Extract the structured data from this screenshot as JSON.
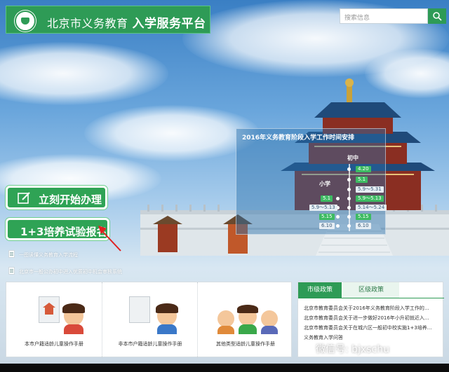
{
  "header": {
    "site_name": "北京市义务教育",
    "platform_name": "入学服务平台"
  },
  "search": {
    "placeholder": "搜索信息",
    "icon": "search-icon"
  },
  "schedule": {
    "title": "2016年义务教育阶段入学工作时间安排",
    "junior_label": "初中",
    "primary_label": "小学",
    "junior_dates": [
      "4.20",
      "5.1",
      "5.9～5.31",
      "5.9～5.13",
      "5.14～5.24",
      "5.15",
      "6.10"
    ],
    "primary_dates": [
      "5.1",
      "5.9～5.13",
      "5.15",
      "6.10"
    ]
  },
  "actions": {
    "start_label": "立刻开始办理",
    "start_icon": "pen-icon",
    "signup_label": "1+3培养试验报名"
  },
  "links": [
    {
      "label": "一图读懂义务教育入学流程"
    },
    {
      "label": "北京市一般公办初中进入优质初中机会审核系统"
    }
  ],
  "manuals": [
    {
      "label": "本市户籍适龄儿童操作手册"
    },
    {
      "label": "非本市户籍适龄儿童操作手册"
    },
    {
      "label": "其他类型适龄儿童操作手册"
    }
  ],
  "policy": {
    "tabs": [
      "市级政策",
      "区级政策"
    ],
    "items": [
      "北京市教育委员会关于2016年义务教育阶段入学工作的...",
      "北京市教育委员会关于进一步做好2016年小升初就近入...",
      "北京市教育委员会关于在城六区一般初中校实施1+3培养...",
      "义务教育入学问答"
    ]
  },
  "watermark": "微信号: bjxschu",
  "colors": {
    "brand_green": "#2e9b56",
    "accent_green": "#3dbb62"
  }
}
